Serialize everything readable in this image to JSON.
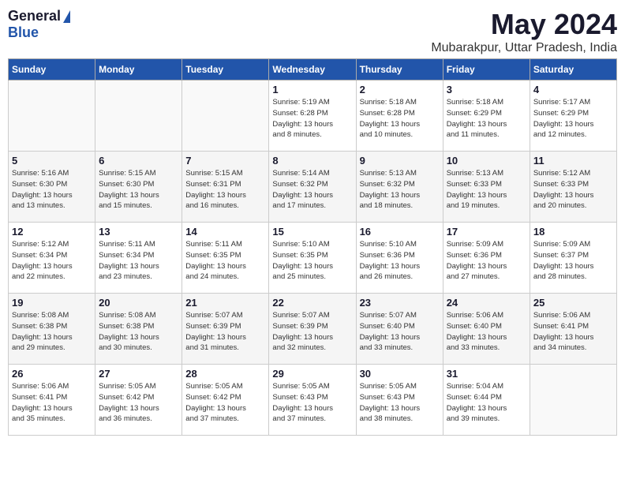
{
  "logo": {
    "general": "General",
    "blue": "Blue"
  },
  "title": "May 2024",
  "location": "Mubarakpur, Uttar Pradesh, India",
  "days_header": [
    "Sunday",
    "Monday",
    "Tuesday",
    "Wednesday",
    "Thursday",
    "Friday",
    "Saturday"
  ],
  "weeks": [
    [
      {
        "day": "",
        "info": ""
      },
      {
        "day": "",
        "info": ""
      },
      {
        "day": "",
        "info": ""
      },
      {
        "day": "1",
        "info": "Sunrise: 5:19 AM\nSunset: 6:28 PM\nDaylight: 13 hours\nand 8 minutes."
      },
      {
        "day": "2",
        "info": "Sunrise: 5:18 AM\nSunset: 6:28 PM\nDaylight: 13 hours\nand 10 minutes."
      },
      {
        "day": "3",
        "info": "Sunrise: 5:18 AM\nSunset: 6:29 PM\nDaylight: 13 hours\nand 11 minutes."
      },
      {
        "day": "4",
        "info": "Sunrise: 5:17 AM\nSunset: 6:29 PM\nDaylight: 13 hours\nand 12 minutes."
      }
    ],
    [
      {
        "day": "5",
        "info": "Sunrise: 5:16 AM\nSunset: 6:30 PM\nDaylight: 13 hours\nand 13 minutes."
      },
      {
        "day": "6",
        "info": "Sunrise: 5:15 AM\nSunset: 6:30 PM\nDaylight: 13 hours\nand 15 minutes."
      },
      {
        "day": "7",
        "info": "Sunrise: 5:15 AM\nSunset: 6:31 PM\nDaylight: 13 hours\nand 16 minutes."
      },
      {
        "day": "8",
        "info": "Sunrise: 5:14 AM\nSunset: 6:32 PM\nDaylight: 13 hours\nand 17 minutes."
      },
      {
        "day": "9",
        "info": "Sunrise: 5:13 AM\nSunset: 6:32 PM\nDaylight: 13 hours\nand 18 minutes."
      },
      {
        "day": "10",
        "info": "Sunrise: 5:13 AM\nSunset: 6:33 PM\nDaylight: 13 hours\nand 19 minutes."
      },
      {
        "day": "11",
        "info": "Sunrise: 5:12 AM\nSunset: 6:33 PM\nDaylight: 13 hours\nand 20 minutes."
      }
    ],
    [
      {
        "day": "12",
        "info": "Sunrise: 5:12 AM\nSunset: 6:34 PM\nDaylight: 13 hours\nand 22 minutes."
      },
      {
        "day": "13",
        "info": "Sunrise: 5:11 AM\nSunset: 6:34 PM\nDaylight: 13 hours\nand 23 minutes."
      },
      {
        "day": "14",
        "info": "Sunrise: 5:11 AM\nSunset: 6:35 PM\nDaylight: 13 hours\nand 24 minutes."
      },
      {
        "day": "15",
        "info": "Sunrise: 5:10 AM\nSunset: 6:35 PM\nDaylight: 13 hours\nand 25 minutes."
      },
      {
        "day": "16",
        "info": "Sunrise: 5:10 AM\nSunset: 6:36 PM\nDaylight: 13 hours\nand 26 minutes."
      },
      {
        "day": "17",
        "info": "Sunrise: 5:09 AM\nSunset: 6:36 PM\nDaylight: 13 hours\nand 27 minutes."
      },
      {
        "day": "18",
        "info": "Sunrise: 5:09 AM\nSunset: 6:37 PM\nDaylight: 13 hours\nand 28 minutes."
      }
    ],
    [
      {
        "day": "19",
        "info": "Sunrise: 5:08 AM\nSunset: 6:38 PM\nDaylight: 13 hours\nand 29 minutes."
      },
      {
        "day": "20",
        "info": "Sunrise: 5:08 AM\nSunset: 6:38 PM\nDaylight: 13 hours\nand 30 minutes."
      },
      {
        "day": "21",
        "info": "Sunrise: 5:07 AM\nSunset: 6:39 PM\nDaylight: 13 hours\nand 31 minutes."
      },
      {
        "day": "22",
        "info": "Sunrise: 5:07 AM\nSunset: 6:39 PM\nDaylight: 13 hours\nand 32 minutes."
      },
      {
        "day": "23",
        "info": "Sunrise: 5:07 AM\nSunset: 6:40 PM\nDaylight: 13 hours\nand 33 minutes."
      },
      {
        "day": "24",
        "info": "Sunrise: 5:06 AM\nSunset: 6:40 PM\nDaylight: 13 hours\nand 33 minutes."
      },
      {
        "day": "25",
        "info": "Sunrise: 5:06 AM\nSunset: 6:41 PM\nDaylight: 13 hours\nand 34 minutes."
      }
    ],
    [
      {
        "day": "26",
        "info": "Sunrise: 5:06 AM\nSunset: 6:41 PM\nDaylight: 13 hours\nand 35 minutes."
      },
      {
        "day": "27",
        "info": "Sunrise: 5:05 AM\nSunset: 6:42 PM\nDaylight: 13 hours\nand 36 minutes."
      },
      {
        "day": "28",
        "info": "Sunrise: 5:05 AM\nSunset: 6:42 PM\nDaylight: 13 hours\nand 37 minutes."
      },
      {
        "day": "29",
        "info": "Sunrise: 5:05 AM\nSunset: 6:43 PM\nDaylight: 13 hours\nand 37 minutes."
      },
      {
        "day": "30",
        "info": "Sunrise: 5:05 AM\nSunset: 6:43 PM\nDaylight: 13 hours\nand 38 minutes."
      },
      {
        "day": "31",
        "info": "Sunrise: 5:04 AM\nSunset: 6:44 PM\nDaylight: 13 hours\nand 39 minutes."
      },
      {
        "day": "",
        "info": ""
      }
    ]
  ]
}
